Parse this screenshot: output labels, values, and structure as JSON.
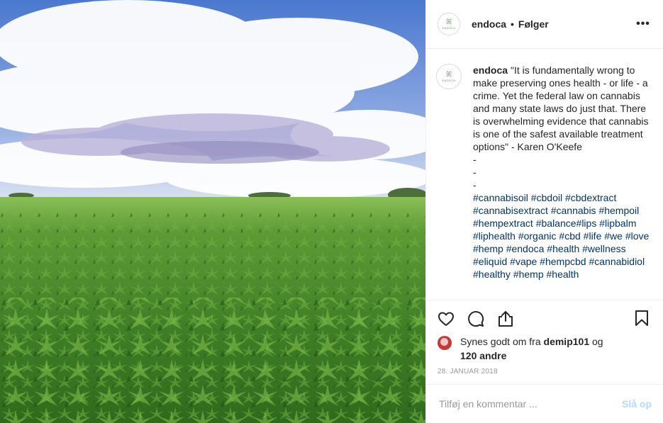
{
  "header": {
    "username": "endoca",
    "separator": "•",
    "follow_status": "Følger",
    "more_label": "•••"
  },
  "avatar": {
    "logo_mark": "ꕤ",
    "logo_word": "ENDOCA"
  },
  "caption": {
    "username": "endoca",
    "lines": [
      "\"It is fundamentally wrong to make preserving ones health - or life - a crime. Yet the federal law on cannabis and many state laws do just that. There is overwhelming evidence that cannabis is one of the safest available treatment options\" - Karen O'Keefe",
      "-",
      "-",
      "-"
    ],
    "hashtags": "#cannabisoil #cbdoil #cbdextract #cannabisextract #cannabis #hempoil #hempextract #balance#lips #lipbalm #liphealth #organic #cbd #life #we #love #hemp #endoca #health #wellness #eliquid #vape #hempcbd #cannabidiol #healthy #hemp #health"
  },
  "actions": {
    "like_icon": "heart-icon",
    "comment_icon": "comment-icon",
    "share_icon": "share-icon",
    "save_icon": "bookmark-icon"
  },
  "likes": {
    "prefix": "Synes godt om fra",
    "user": "demip101",
    "conjunction": "og",
    "others": "120 andre"
  },
  "date": "28. JANUAR 2018",
  "comment_box": {
    "placeholder": "Tilføj en kommentar ...",
    "post_label": "Slå op"
  },
  "colors": {
    "link": "#003569",
    "post_disabled": "#b3dbff",
    "muted": "#999999",
    "border": "#efefef"
  }
}
